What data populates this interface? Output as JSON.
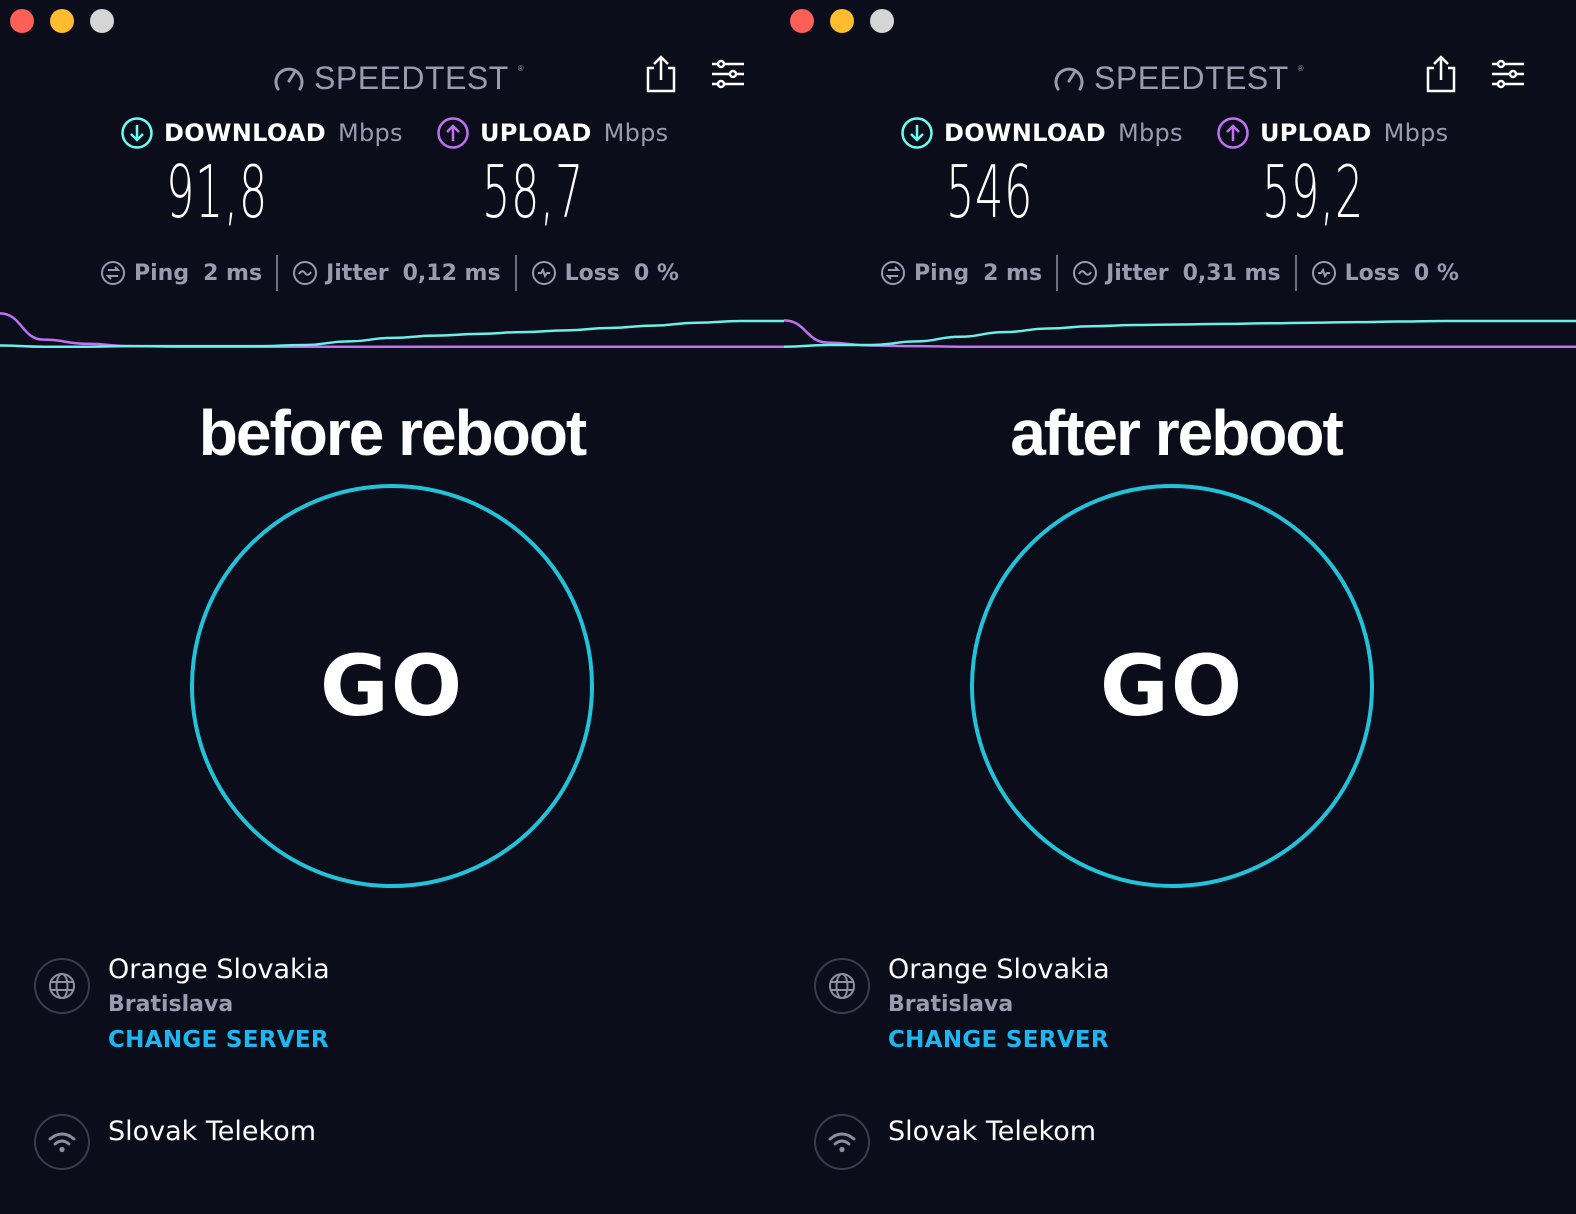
{
  "colors": {
    "background": "#0b0d1a",
    "download_accent": "#6afff3",
    "upload_accent": "#bf71f2",
    "go_ring": "#22c3d9",
    "link": "#1fb6f0",
    "muted_text": "#9a9bb0"
  },
  "panels": [
    {
      "app": {
        "logo_text": "SPEEDTEST",
        "logo_mark": "®",
        "icons": {
          "share": "share-icon",
          "settings": "settings-sliders-icon"
        }
      },
      "download": {
        "label": "DOWNLOAD",
        "unit": "Mbps",
        "value": "91,8",
        "icon": "arrow-down-circle-icon"
      },
      "upload": {
        "label": "UPLOAD",
        "unit": "Mbps",
        "value": "58,7",
        "icon": "arrow-up-circle-icon"
      },
      "stats": {
        "ping": {
          "label": "Ping",
          "value": "2 ms"
        },
        "jitter": {
          "label": "Jitter",
          "value": "0,12 ms"
        },
        "loss": {
          "label": "Loss",
          "value": "0 %"
        }
      },
      "caption": "before reboot",
      "go_label": "GO",
      "server": {
        "name": "Orange Slovakia",
        "location": "Bratislava",
        "change_label": "CHANGE SERVER"
      },
      "isp": {
        "name": "Slovak Telekom"
      },
      "graph": {
        "download_trend": [
          0.35,
          0.33,
          0.33,
          0.34,
          0.34,
          0.34,
          0.34,
          0.36,
          0.42,
          0.48,
          0.52,
          0.55,
          0.58,
          0.61,
          0.65,
          0.69,
          0.74,
          0.77,
          0.77
        ],
        "upload_trend": [
          0.9,
          0.45,
          0.38,
          0.34,
          0.33,
          0.33,
          0.33,
          0.33,
          0.33,
          0.33,
          0.33,
          0.33,
          0.33,
          0.33,
          0.33,
          0.33,
          0.33,
          0.33,
          0.33
        ]
      }
    },
    {
      "app": {
        "logo_text": "SPEEDTEST",
        "logo_mark": "®",
        "icons": {
          "share": "share-icon",
          "settings": "settings-sliders-icon"
        }
      },
      "download": {
        "label": "DOWNLOAD",
        "unit": "Mbps",
        "value": "546",
        "icon": "arrow-down-circle-icon"
      },
      "upload": {
        "label": "UPLOAD",
        "unit": "Mbps",
        "value": "59,2",
        "icon": "arrow-up-circle-icon"
      },
      "stats": {
        "ping": {
          "label": "Ping",
          "value": "2 ms"
        },
        "jitter": {
          "label": "Jitter",
          "value": "0,31 ms"
        },
        "loss": {
          "label": "Loss",
          "value": "0 %"
        }
      },
      "caption": "after reboot",
      "go_label": "GO",
      "server": {
        "name": "Orange Slovakia",
        "location": "Bratislava",
        "change_label": "CHANGE SERVER"
      },
      "isp": {
        "name": "Slovak Telekom"
      },
      "graph": {
        "download_trend": [
          0.33,
          0.36,
          0.36,
          0.42,
          0.5,
          0.58,
          0.64,
          0.68,
          0.7,
          0.71,
          0.72,
          0.73,
          0.74,
          0.75,
          0.76,
          0.77,
          0.77,
          0.77,
          0.77
        ],
        "upload_trend": [
          0.78,
          0.4,
          0.35,
          0.34,
          0.33,
          0.33,
          0.33,
          0.33,
          0.33,
          0.33,
          0.33,
          0.33,
          0.33,
          0.33,
          0.33,
          0.33,
          0.33,
          0.33,
          0.33
        ]
      }
    }
  ]
}
